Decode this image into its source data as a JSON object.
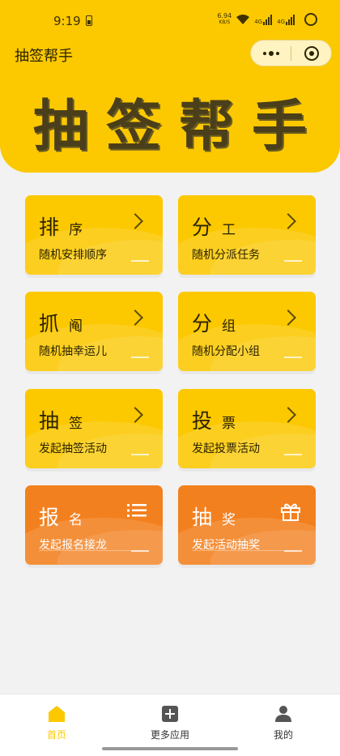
{
  "status": {
    "time": "9:19",
    "speed": "6.94",
    "speed_unit": "KB/S",
    "net1": "4G",
    "net2": "4G"
  },
  "nav": {
    "title": "抽签帮手"
  },
  "hero": {
    "text": "抽签帮手"
  },
  "cards": [
    {
      "big": "排",
      "small": "序",
      "sub": "随机安排顺序"
    },
    {
      "big": "分",
      "small": "工",
      "sub": "随机分派任务"
    },
    {
      "big": "抓",
      "small": "阄",
      "sub": "随机抽幸运儿"
    },
    {
      "big": "分",
      "small": "组",
      "sub": "随机分配小组"
    },
    {
      "big": "抽",
      "small": "签",
      "sub": "发起抽签活动"
    },
    {
      "big": "投",
      "small": "票",
      "sub": "发起投票活动"
    },
    {
      "big": "报",
      "small": "名",
      "sub": "发起报名接龙"
    },
    {
      "big": "抽",
      "small": "奖",
      "sub": "发起活动抽奖"
    }
  ],
  "tabs": [
    {
      "label": "首页",
      "icon": "home-icon"
    },
    {
      "label": "更多应用",
      "icon": "apps-icon"
    },
    {
      "label": "我的",
      "icon": "user-icon"
    }
  ],
  "colors": {
    "primary": "#fcc800",
    "accent": "#f3801e"
  }
}
